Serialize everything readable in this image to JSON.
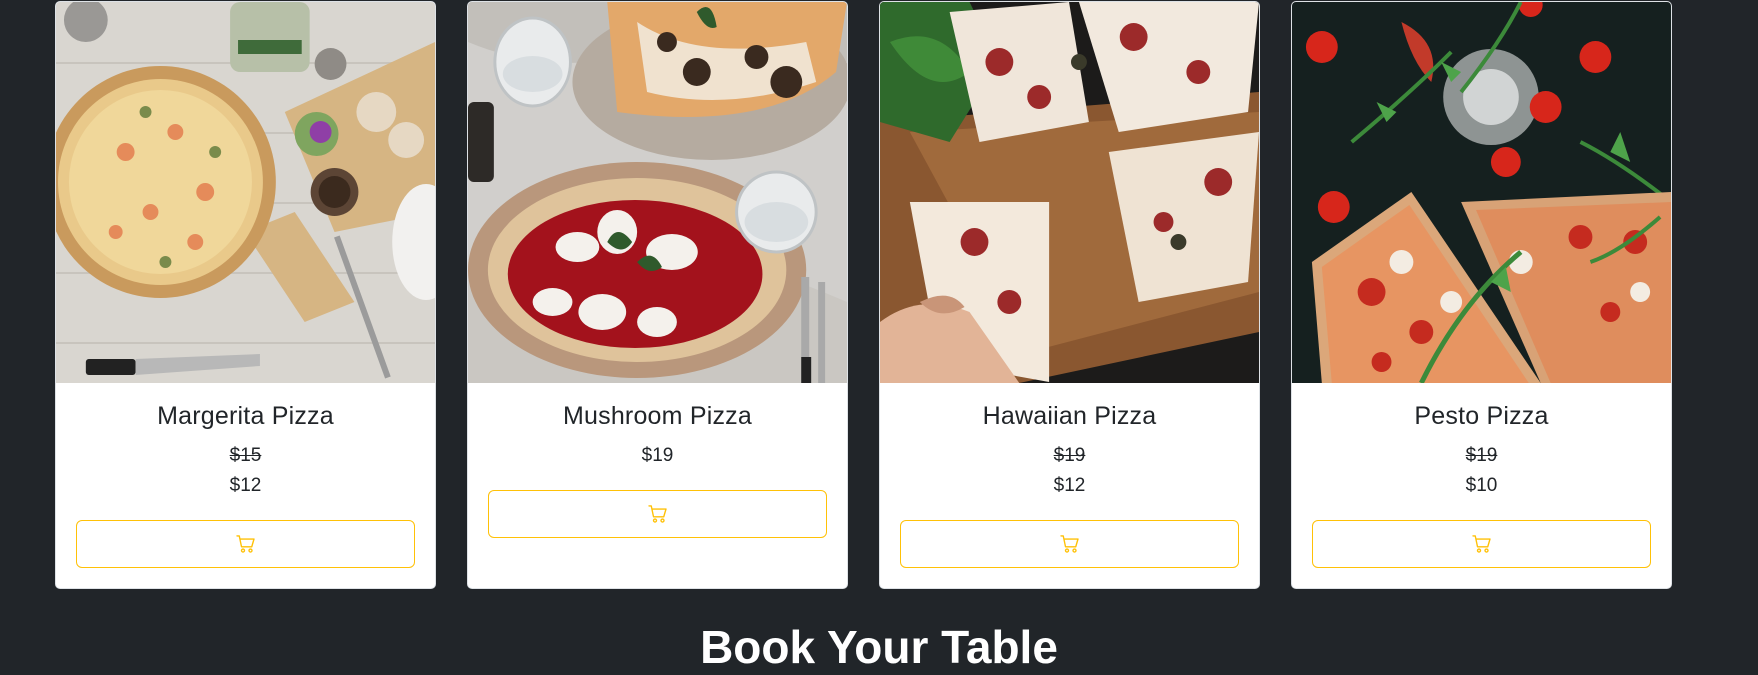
{
  "colors": {
    "page_background": "#212529",
    "card_background": "#ffffff",
    "button_border": "#ffc107",
    "cart_icon": "#ffc107",
    "text": "#212529",
    "heading": "#ffffff"
  },
  "products": [
    {
      "name": "Margerita Pizza",
      "old_price": "$15",
      "price": "$12",
      "image_subject": "pizza-photo-margerita",
      "button_icon": "cart-icon"
    },
    {
      "name": "Mushroom Pizza",
      "old_price": null,
      "price": "$19",
      "image_subject": "pizza-photo-mushroom",
      "button_icon": "cart-icon"
    },
    {
      "name": "Hawaiian Pizza",
      "old_price": "$19",
      "price": "$12",
      "image_subject": "pizza-photo-hawaiian",
      "button_icon": "cart-icon"
    },
    {
      "name": "Pesto Pizza",
      "old_price": "$19",
      "price": "$10",
      "image_subject": "pizza-photo-pesto",
      "button_icon": "cart-icon"
    }
  ],
  "section": {
    "heading": "Book Your Table"
  }
}
